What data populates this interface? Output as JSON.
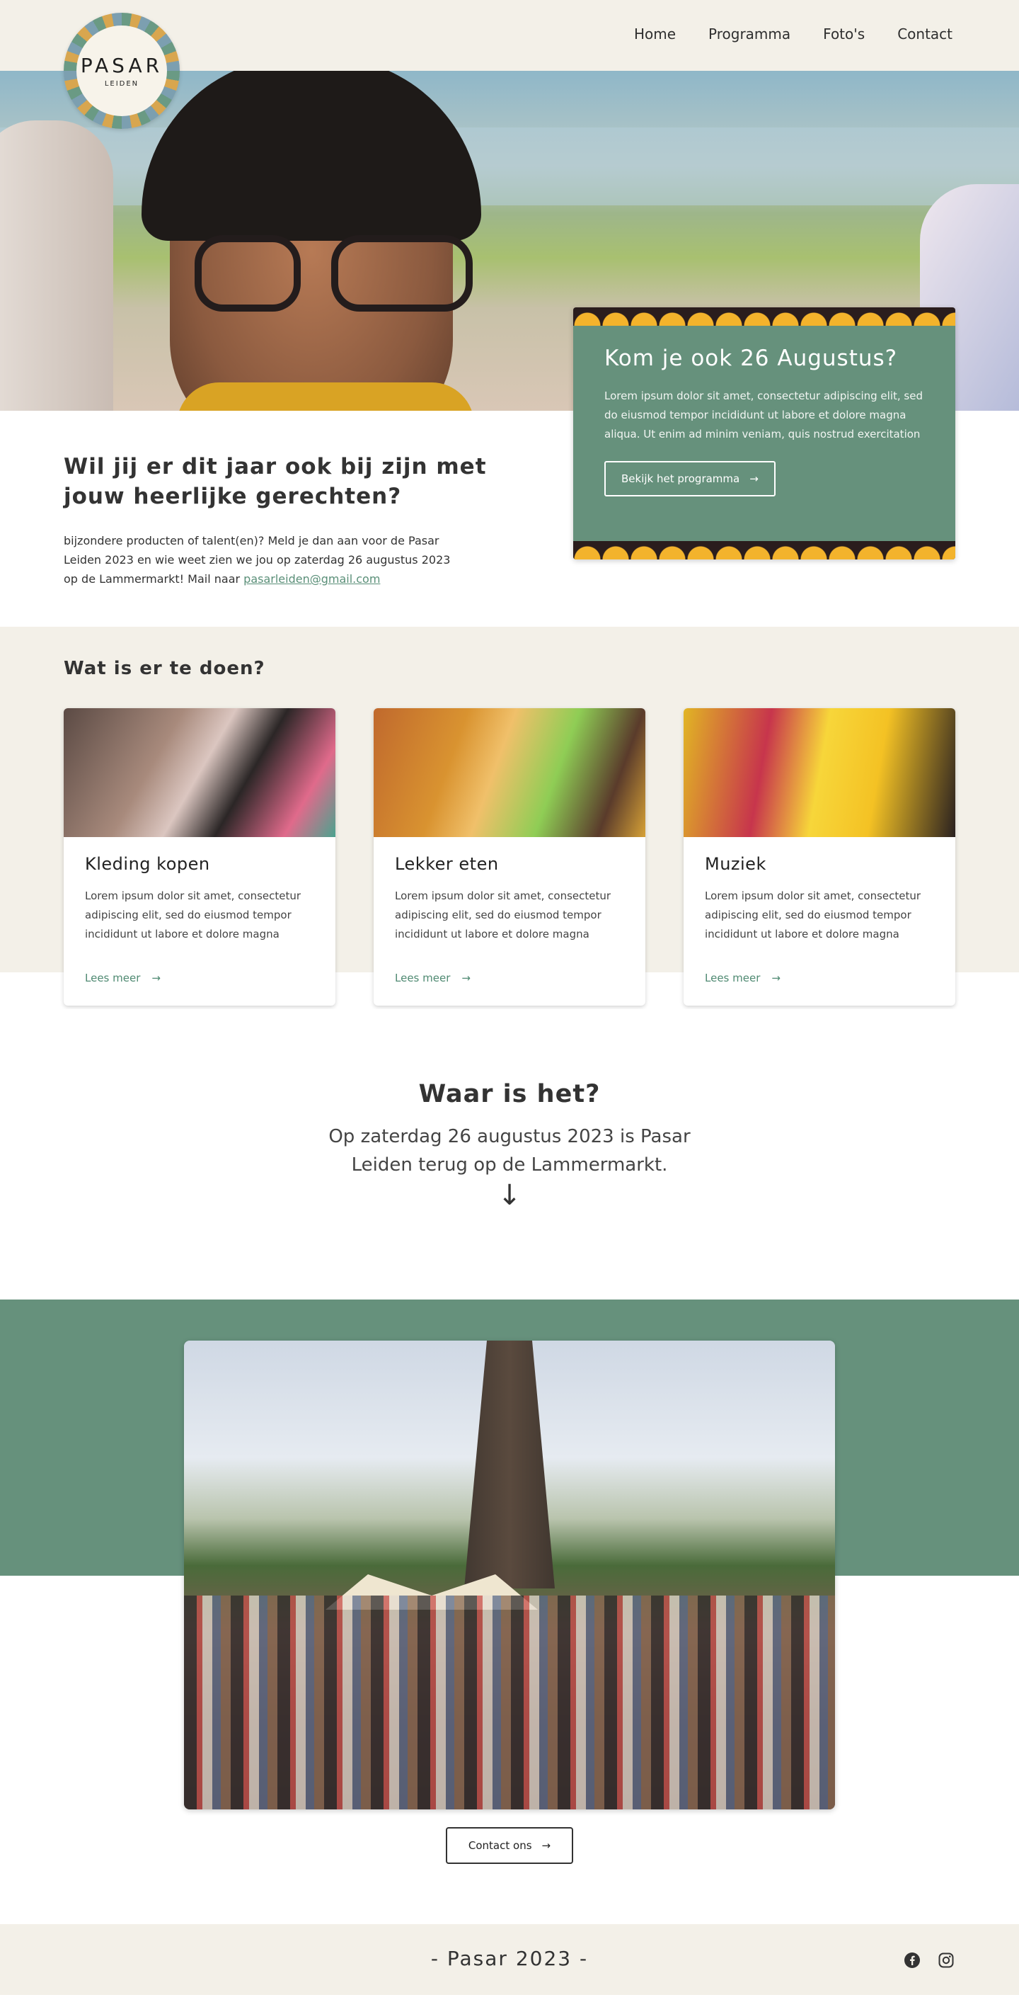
{
  "header": {
    "logo": {
      "word": "PASAR",
      "sub": "LEIDEN"
    },
    "nav": [
      {
        "label": "Home"
      },
      {
        "label": "Programma"
      },
      {
        "label": "Foto's"
      },
      {
        "label": "Contact"
      }
    ]
  },
  "promo": {
    "title": "Kom je ook 26 Augustus?",
    "text": "Lorem ipsum dolor sit amet, consectetur adipiscing elit, sed do eiusmod tempor incididunt ut labore et dolore magna aliqua. Ut enim ad minim veniam, quis nostrud exercitation",
    "button": "Bekijk het programma"
  },
  "intro": {
    "title": "Wil jij er dit jaar ook bij zijn met jouw heerlijke gerechten?",
    "text": "bijzondere producten of talent(en)? Meld je dan aan voor de Pasar Leiden 2023 en wie weet zien we jou op zaterdag 26 augustus 2023 op de Lammermarkt! Mail naar ",
    "email": "pasarleiden@gmail.com"
  },
  "activities": {
    "heading": "Wat is er te doen?",
    "cards": [
      {
        "title": "Kleding kopen",
        "text": "Lorem ipsum dolor sit amet, consectetur adipiscing elit, sed do eiusmod tempor incididunt ut labore et dolore magna",
        "link": "Lees meer"
      },
      {
        "title": "Lekker eten",
        "text": "Lorem ipsum dolor sit amet, consectetur adipiscing elit, sed do eiusmod tempor incididunt ut labore et dolore magna",
        "link": "Lees meer"
      },
      {
        "title": "Muziek",
        "text": "Lorem ipsum dolor sit amet, consectetur adipiscing elit, sed do eiusmod tempor incididunt ut labore et dolore magna",
        "link": "Lees meer"
      }
    ]
  },
  "where": {
    "title": "Waar is het?",
    "text": "Op zaterdag 26 augustus 2023 is Pasar Leiden terug op de Lammermarkt."
  },
  "contact": {
    "button": "Contact ons"
  },
  "footer": {
    "title": "- Pasar 2023 -"
  },
  "colors": {
    "accent_green": "#66917c",
    "cream": "#f3f0e8",
    "link_green": "#4f8a72"
  },
  "icons": {
    "arrow": "arrow-right-icon",
    "down": "arrow-down-icon",
    "facebook": "facebook-icon",
    "instagram": "instagram-icon"
  }
}
